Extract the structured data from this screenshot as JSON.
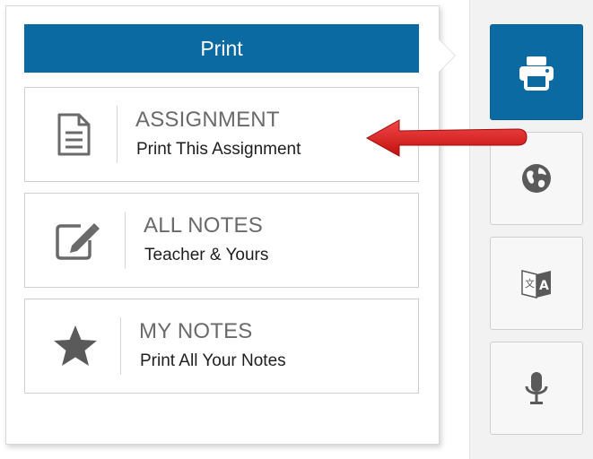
{
  "print_panel": {
    "header": "Print",
    "options": [
      {
        "title": "ASSIGNMENT",
        "subtitle": "Print This Assignment",
        "icon": "document-icon"
      },
      {
        "title": "ALL NOTES",
        "subtitle": "Teacher & Yours",
        "icon": "edit-note-icon"
      },
      {
        "title": "MY NOTES",
        "subtitle": "Print All Your Notes",
        "icon": "star-icon"
      }
    ]
  },
  "toolbar": {
    "buttons": [
      {
        "icon": "printer-icon",
        "active": true
      },
      {
        "icon": "globe-icon",
        "active": false
      },
      {
        "icon": "translate-icon",
        "active": false
      },
      {
        "icon": "microphone-icon",
        "active": false
      }
    ]
  },
  "colors": {
    "accent": "#0b6aa2",
    "annotation_arrow": "#e01b1b"
  }
}
